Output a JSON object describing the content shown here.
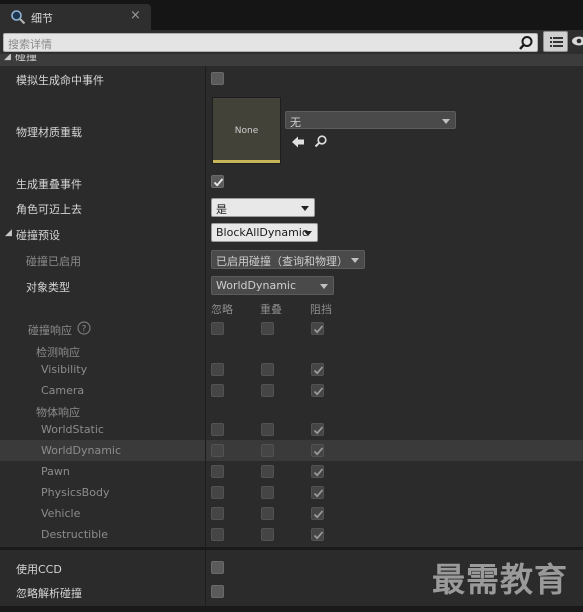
{
  "tab": {
    "title": "细节",
    "close_symbol": "×"
  },
  "search": {
    "placeholder": "搜索详情"
  },
  "section": {
    "title": "碰撞"
  },
  "properties": {
    "simulation_hit_events": "模拟生成命中事件",
    "phys_material_override": "物理材质重载",
    "material_thumb_text": "None",
    "material_select": "无",
    "generate_overlap_events": "生成重叠事件",
    "can_character_step_up": "角色可迈上去",
    "can_step_up_value": "是",
    "collision_presets": "碰撞预设",
    "collision_presets_value": "BlockAllDynamic",
    "collision_enabled": "碰撞已启用",
    "collision_enabled_value": "已启用碰撞（查询和物理）",
    "object_type": "对象类型",
    "object_type_value": "WorldDynamic",
    "collision_responses": "碰撞响应",
    "trace_responses": "检测响应",
    "object_responses": "物体响应",
    "use_ccd": "使用CCD",
    "ignore_analytic_collisions": "忽略解析碰撞"
  },
  "response_columns": [
    "忽略",
    "重叠",
    "阻挡"
  ],
  "trace_channels": [
    "Visibility",
    "Camera"
  ],
  "object_channels": [
    "WorldStatic",
    "WorldDynamic",
    "Pawn",
    "PhysicsBody",
    "Vehicle",
    "Destructible"
  ],
  "checked_state": {
    "simulation_hit_events": false,
    "generate_overlap_events": true,
    "use_ccd": false,
    "ignore_analytic_collisions": false,
    "all_channels_block": true
  },
  "watermark": "最需教育",
  "colors": {
    "panel": "#2b2b2b",
    "header": "#3c3c3c",
    "accent_bar": "#c8b65a"
  }
}
